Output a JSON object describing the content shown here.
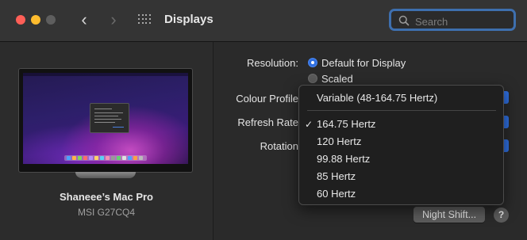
{
  "window": {
    "title": "Displays",
    "nav_back_glyph": "‹",
    "nav_forward_glyph": "›",
    "search": {
      "placeholder": "Search",
      "value": ""
    }
  },
  "device": {
    "name": "Shaneee’s Mac Pro",
    "model": "MSI G27CQ4"
  },
  "settings": {
    "resolution_label": "Resolution:",
    "resolution_options": [
      "Default for Display",
      "Scaled"
    ],
    "resolution_selected": "Default for Display",
    "colour_profile_label": "Colour Profile",
    "refresh_rate_label": "Refresh Rate",
    "rotation_label": "Rotation",
    "night_shift_button": "Night Shift...",
    "help_button": "?"
  },
  "refresh_menu": {
    "header_item": "Variable (48-164.75 Hertz)",
    "items": [
      "164.75 Hertz",
      "120 Hertz",
      "99.88 Hertz",
      "85 Hertz",
      "60 Hertz"
    ],
    "selected": "164.75 Hertz",
    "check_glyph": "✓"
  },
  "colors": {
    "accent": "#2f6fe0",
    "search_focus_ring": "#3e6fae",
    "close": "#ff5f57",
    "minimize": "#febc2e",
    "zoom_inactive": "#5e5e5e"
  }
}
